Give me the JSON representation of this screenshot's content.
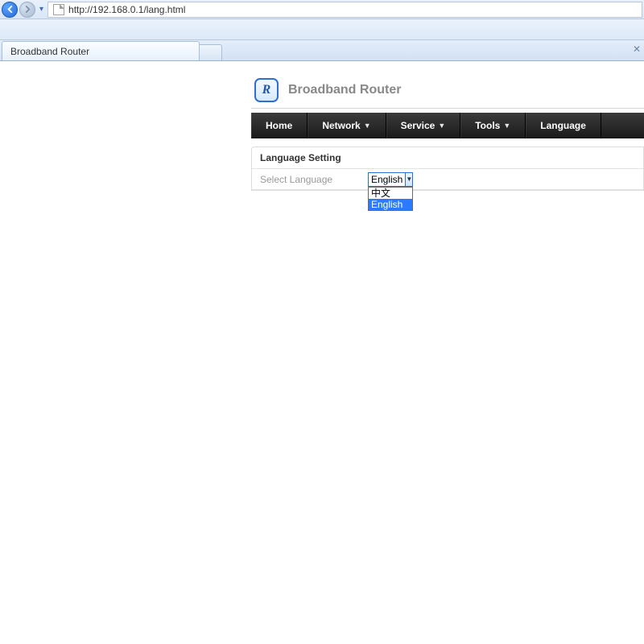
{
  "browser": {
    "url": "http://192.168.0.1/lang.html",
    "tab_title": "Broadband Router"
  },
  "router": {
    "logo_letter": "R",
    "title": "Broadband Router",
    "nav": {
      "home": "Home",
      "network": "Network",
      "service": "Service",
      "tools": "Tools",
      "language": "Language"
    },
    "panel": {
      "heading": "Language Setting",
      "label": "Select Language",
      "selected": "English",
      "options": {
        "zh": "中文",
        "en": "English"
      }
    }
  }
}
